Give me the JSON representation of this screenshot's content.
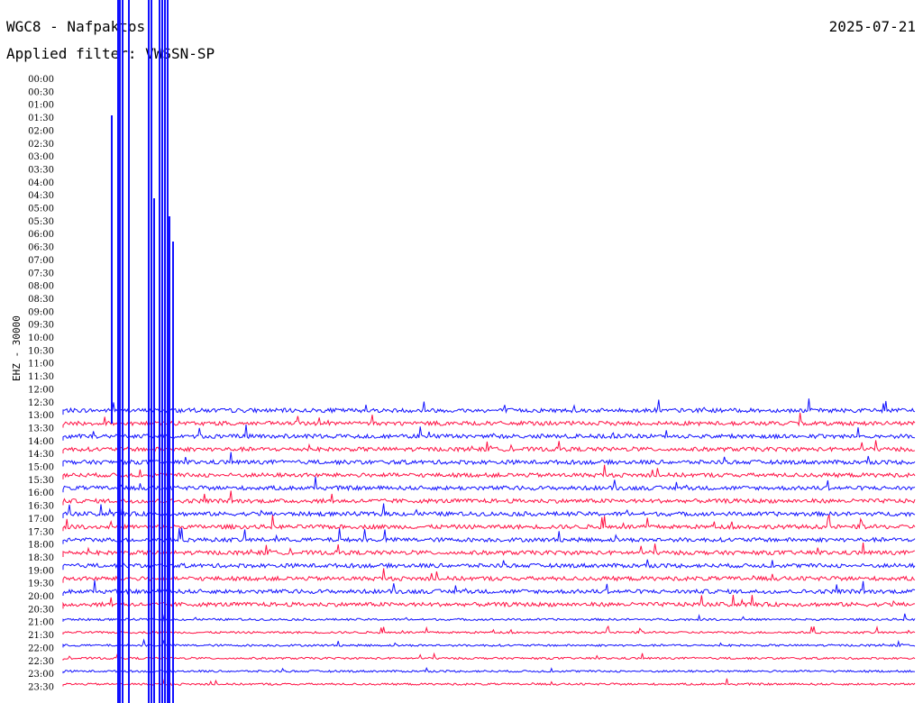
{
  "header": {
    "title": "WGC8 - Nafpaktos",
    "filter": "Applied filter: VWSSN-SP",
    "date": "2025-07-21"
  },
  "colors": {
    "blue": "#1010ff",
    "red": "#ff1144"
  },
  "chart_data": {
    "type": "line",
    "title": "WGC8 - Nafpaktos",
    "ylabel": "EHZ - 30000",
    "row_labels": [
      "00:00",
      "00:30",
      "01:00",
      "01:30",
      "02:00",
      "02:30",
      "03:00",
      "03:30",
      "04:00",
      "04:30",
      "05:00",
      "05:30",
      "06:00",
      "06:30",
      "07:00",
      "07:30",
      "08:00",
      "08:30",
      "09:00",
      "09:30",
      "10:00",
      "10:30",
      "11:00",
      "11:30",
      "12:00",
      "12:30",
      "13:00",
      "13:30",
      "14:00",
      "14:30",
      "15:00",
      "15:30",
      "16:00",
      "16:30",
      "17:00",
      "17:30",
      "18:00",
      "18:30",
      "19:00",
      "19:30",
      "20:00",
      "20:30",
      "21:00",
      "21:30",
      "22:00",
      "22:30",
      "23:00",
      "23:30"
    ],
    "first_trace_row": "13:00",
    "line_colors_alternating": [
      "blue",
      "red"
    ],
    "grid": false
  }
}
